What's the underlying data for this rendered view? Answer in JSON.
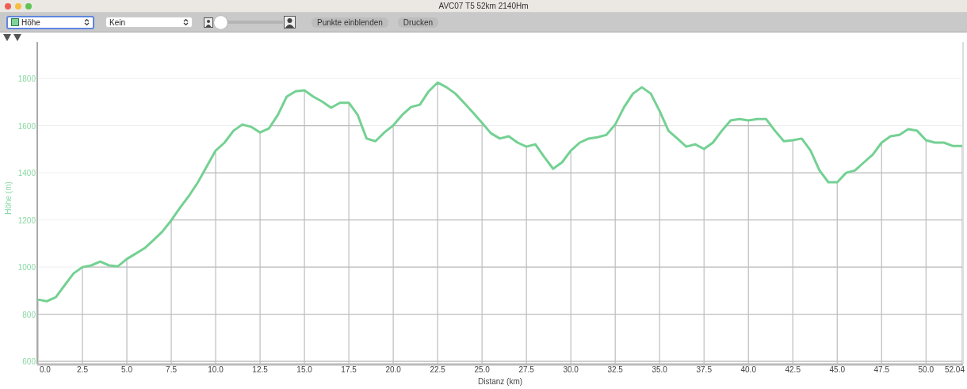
{
  "window": {
    "title": "AVC07 T5 52km 2140Hm"
  },
  "toolbar": {
    "selects": [
      {
        "value": "Höhe",
        "kind": "series",
        "focused": true
      },
      {
        "value": "Kein",
        "kind": "plain",
        "focused": false
      }
    ],
    "zoom_slider": {
      "level": 0
    },
    "buttons": [
      "Punkte einblenden",
      "Drucken"
    ]
  },
  "chart": {
    "chart_data": {
      "type": "line",
      "xlabel": "Distanz (km)",
      "ylabel": "Höhe (m)",
      "x": [
        0,
        0.5,
        1,
        1.5,
        2,
        2.5,
        3,
        3.5,
        4,
        4.5,
        5,
        5.5,
        6,
        6.5,
        7,
        7.5,
        8,
        8.5,
        9,
        9.5,
        10,
        10.5,
        11,
        11.5,
        12,
        12.5,
        13,
        13.5,
        14,
        14.5,
        15,
        15.5,
        16,
        16.5,
        17,
        17.5,
        18,
        18.5,
        19,
        19.5,
        20,
        20.5,
        21,
        21.5,
        22,
        22.5,
        23,
        23.5,
        24,
        24.5,
        25,
        25.5,
        26,
        26.5,
        27,
        27.5,
        28,
        28.5,
        29,
        29.5,
        30,
        30.5,
        31,
        31.5,
        32,
        32.5,
        33,
        33.5,
        34,
        34.5,
        35,
        35.5,
        36,
        36.5,
        37,
        37.5,
        38,
        38.5,
        39,
        39.5,
        40,
        40.5,
        41,
        41.5,
        42,
        42.5,
        43,
        43.5,
        44,
        44.5,
        45,
        45.5,
        46,
        46.5,
        47,
        47.5,
        48,
        48.5,
        49,
        49.5,
        50,
        50.5,
        51,
        51.5,
        52.04
      ],
      "series": [
        {
          "color": "#74d193",
          "values": [
            862,
            855,
            872,
            923,
            973,
            1000,
            1007,
            1023,
            1007,
            1003,
            1034,
            1057,
            1080,
            1114,
            1150,
            1198,
            1252,
            1302,
            1360,
            1427,
            1494,
            1528,
            1578,
            1605,
            1595,
            1571,
            1588,
            1645,
            1723,
            1746,
            1750,
            1723,
            1702,
            1676,
            1697,
            1697,
            1645,
            1545,
            1534,
            1571,
            1601,
            1645,
            1679,
            1689,
            1746,
            1783,
            1763,
            1736,
            1696,
            1655,
            1612,
            1568,
            1545,
            1555,
            1528,
            1511,
            1521,
            1467,
            1417,
            1444,
            1494,
            1528,
            1545,
            1551,
            1561,
            1605,
            1679,
            1736,
            1763,
            1736,
            1662,
            1578,
            1545,
            1511,
            1521,
            1501,
            1528,
            1578,
            1622,
            1628,
            1622,
            1628,
            1628,
            1578,
            1534,
            1538,
            1545,
            1494,
            1410,
            1360,
            1360,
            1400,
            1410,
            1444,
            1477,
            1528,
            1555,
            1561,
            1585,
            1578,
            1538,
            1528,
            1528,
            1514,
            1514
          ]
        }
      ],
      "xlim": [
        0,
        52.04
      ],
      "ylim": [
        590,
        1955
      ],
      "grid": true,
      "xticks": [
        {
          "value": 0,
          "label": "0.0"
        },
        {
          "value": 2.5,
          "label": "2.5"
        },
        {
          "value": 5,
          "label": "5.0"
        },
        {
          "value": 7.5,
          "label": "7.5"
        },
        {
          "value": 10,
          "label": "10.0"
        },
        {
          "value": 12.5,
          "label": "12.5"
        },
        {
          "value": 15,
          "label": "15.0"
        },
        {
          "value": 17.5,
          "label": "17.5"
        },
        {
          "value": 20,
          "label": "20.0"
        },
        {
          "value": 22.5,
          "label": "22.5"
        },
        {
          "value": 25,
          "label": "25.0"
        },
        {
          "value": 27.5,
          "label": "27.5"
        },
        {
          "value": 30,
          "label": "30.0"
        },
        {
          "value": 32.5,
          "label": "32.5"
        },
        {
          "value": 35,
          "label": "35.0"
        },
        {
          "value": 37.5,
          "label": "37.5"
        },
        {
          "value": 40,
          "label": "40.0"
        },
        {
          "value": 42.5,
          "label": "42.5"
        },
        {
          "value": 45,
          "label": "45.0"
        },
        {
          "value": 47.5,
          "label": "47.5"
        },
        {
          "value": 50,
          "label": "50.0"
        },
        {
          "value": 52.04,
          "label": "52.04"
        }
      ],
      "yticks": [
        600,
        800,
        1000,
        1200,
        1400,
        1600,
        1800
      ]
    }
  }
}
